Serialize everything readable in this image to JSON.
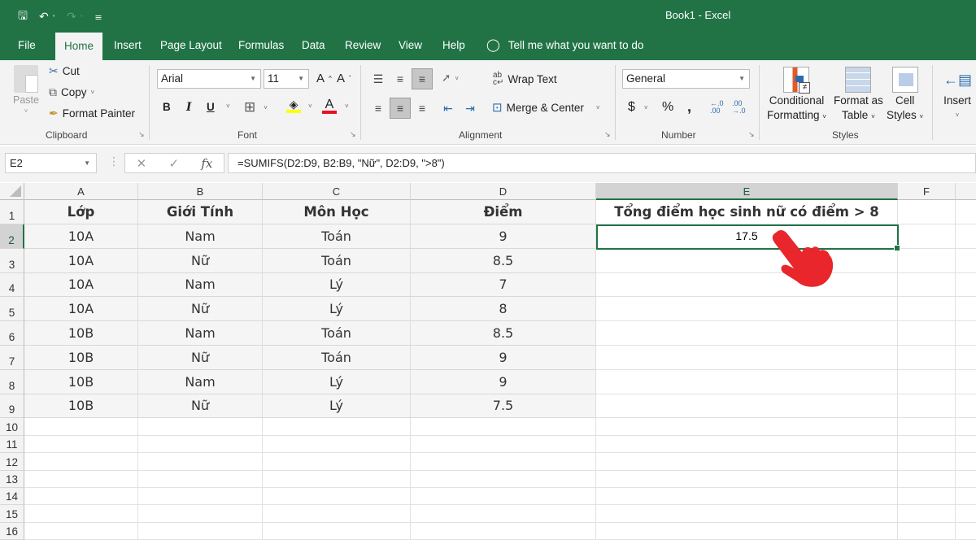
{
  "window": {
    "title": "Book1  -  Excel"
  },
  "quick_access": {
    "icons": [
      "save-icon",
      "undo-icon",
      "redo-icon",
      "customize-icon"
    ]
  },
  "tabs": [
    {
      "label": "File",
      "active": false
    },
    {
      "label": "Home",
      "active": true
    },
    {
      "label": "Insert",
      "active": false
    },
    {
      "label": "Page Layout",
      "active": false
    },
    {
      "label": "Formulas",
      "active": false
    },
    {
      "label": "Data",
      "active": false
    },
    {
      "label": "Review",
      "active": false
    },
    {
      "label": "View",
      "active": false
    },
    {
      "label": "Help",
      "active": false
    }
  ],
  "tell_me": "Tell me what you want to do",
  "ribbon": {
    "clipboard": {
      "label": "Clipboard",
      "paste": "Paste",
      "cut": "Cut",
      "copy": "Copy",
      "format_painter": "Format Painter"
    },
    "font": {
      "label": "Font",
      "family": "Arial",
      "size": "11",
      "bold": "B",
      "italic": "I",
      "underline": "U",
      "fill_color": "#ffff00",
      "font_color": "#e81123"
    },
    "alignment": {
      "label": "Alignment",
      "wrap_text": "Wrap Text",
      "merge_center": "Merge & Center"
    },
    "number": {
      "label": "Number",
      "format": "General",
      "currency": "$",
      "percent": "%",
      "comma": ",",
      "inc_decimal": "←.0 .00",
      "dec_decimal": ".00 →.0"
    },
    "styles": {
      "label": "Styles",
      "conditional_formatting": [
        "Conditional",
        "Formatting"
      ],
      "format_as_table": [
        "Format as",
        "Table"
      ],
      "cell_styles": [
        "Cell",
        "Styles"
      ]
    },
    "cells": {
      "insert": "Insert"
    }
  },
  "formula_bar": {
    "name_box": "E2",
    "fx": "fx",
    "formula": "=SUMIFS(D2:D9, B2:B9, \"Nữ\", D2:D9, \">8\")"
  },
  "sheet": {
    "columns": [
      "A",
      "B",
      "C",
      "D",
      "E",
      "F"
    ],
    "selected_column": "E",
    "selected_row": "2",
    "row_numbers": [
      "1",
      "2",
      "3",
      "4",
      "5",
      "6",
      "7",
      "8",
      "9",
      "10",
      "11",
      "12",
      "13",
      "14",
      "15",
      "16"
    ],
    "header": [
      "Lớp",
      "Giới Tính",
      "Môn Học",
      "Điểm",
      "Tổng điểm học sinh nữ có điểm > 8"
    ],
    "rows": [
      [
        "10A",
        "Nam",
        "Toán",
        "9"
      ],
      [
        "10A",
        "Nữ",
        "Toán",
        "8.5"
      ],
      [
        "10A",
        "Nam",
        "Lý",
        "7"
      ],
      [
        "10A",
        "Nữ",
        "Lý",
        "8"
      ],
      [
        "10B",
        "Nam",
        "Toán",
        "8.5"
      ],
      [
        "10B",
        "Nữ",
        "Toán",
        "9"
      ],
      [
        "10B",
        "Nam",
        "Lý",
        "9"
      ],
      [
        "10B",
        "Nữ",
        "Lý",
        "7.5"
      ]
    ],
    "result_cell": {
      "ref": "E2",
      "value": "17.5"
    },
    "accent": "#217346",
    "pointer_color": "#e8262c"
  }
}
